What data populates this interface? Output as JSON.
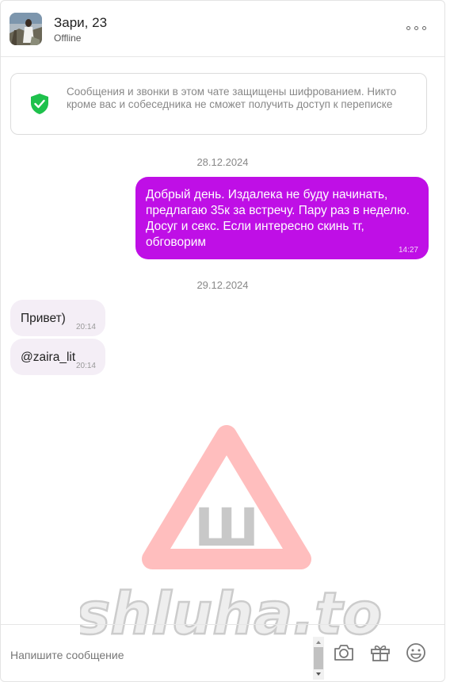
{
  "header": {
    "name": "Зари, 23",
    "status": "Offline"
  },
  "notice": {
    "text": "Сообщения и звонки в этом чате защищены шифрованием. Никто кроме вас и собеседника не сможет получить доступ к переписке"
  },
  "messages": [
    {
      "date": "28.12.2024"
    },
    {
      "direction": "out",
      "text": "Добрый день. Издалека не буду начинать, предлагаю 35к за встречу. Пару раз в неделю. Досуг и секс. Если интересно скинь тг, обговорим",
      "time": "14:27"
    },
    {
      "date": "29.12.2024"
    },
    {
      "direction": "in",
      "text": "Привет)",
      "time": "20:14"
    },
    {
      "direction": "in",
      "text": "@zaira_lit",
      "time": "20:14"
    }
  ],
  "watermark": {
    "letter": "Ш",
    "text": "shluha.to"
  },
  "input": {
    "placeholder": "Напишите сообщение"
  },
  "icons": {
    "menu": "more-dots-icon",
    "shield": "shield-check-icon",
    "camera": "camera-icon",
    "gift": "gift-icon",
    "emoji": "emoji-icon"
  },
  "colors": {
    "accent": "#bf0fe6",
    "shield": "#1ec14c",
    "incoming_bubble": "#f4eef6"
  }
}
